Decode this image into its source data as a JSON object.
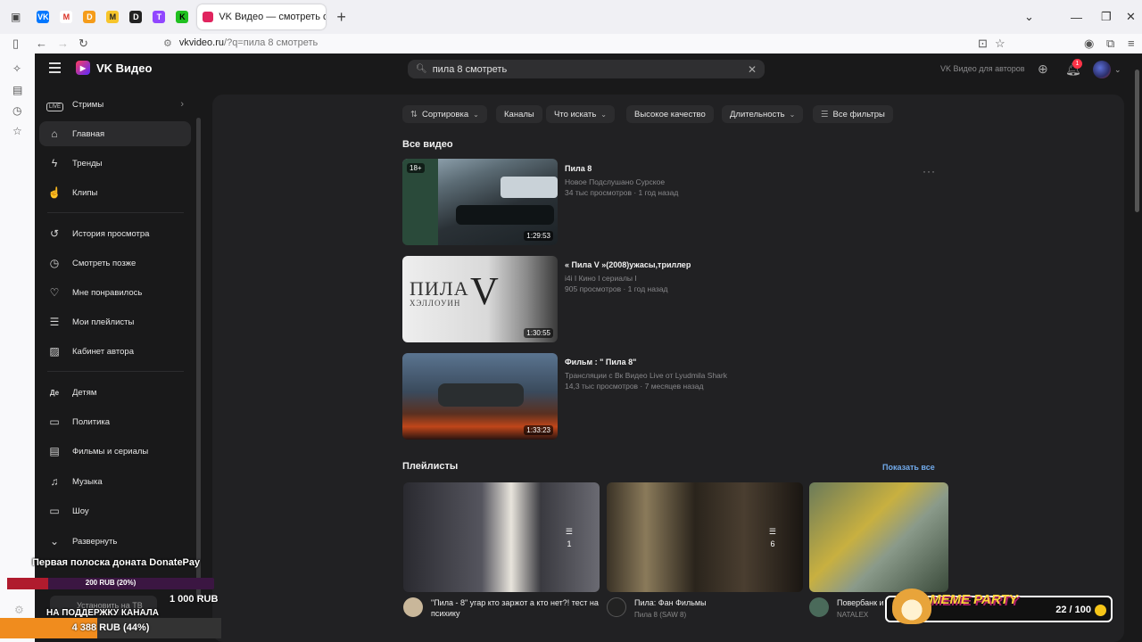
{
  "browser": {
    "tab_title": "VK Видео — смотреть онлайн",
    "url_domain": "vkvideo.ru",
    "url_path": "/?q=пила 8 смотреть",
    "pinned_tabs": [
      {
        "name": "vk-pinned-tab",
        "label": "VK",
        "color": "#0077ff"
      },
      {
        "name": "gmail-pinned-tab",
        "label": "M",
        "color": "#d93025"
      },
      {
        "name": "donationalerts-pinned-tab",
        "label": "D",
        "color": "#f59c1a"
      },
      {
        "name": "miro-pinned-tab",
        "label": "M",
        "color": "#f7c52b"
      },
      {
        "name": "dtf-pinned-tab",
        "label": "D",
        "color": "#222222"
      },
      {
        "name": "twitch-pinned-tab",
        "label": "T",
        "color": "#9146ff"
      },
      {
        "name": "kick-pinned-tab",
        "label": "K",
        "color": "#20c020"
      }
    ]
  },
  "header": {
    "logo": "VK Видео",
    "search_value": "пила 8 смотреть",
    "authors_link": "VK Видео для авторов",
    "notifications_count": "1"
  },
  "sidebar": {
    "items": [
      {
        "label": "Стримы",
        "icon": "live-icon"
      },
      {
        "label": "Главная",
        "icon": "home-icon"
      },
      {
        "label": "Тренды",
        "icon": "lightning-icon"
      },
      {
        "label": "Клипы",
        "icon": "clips-icon"
      },
      {
        "label": "История просмотра",
        "icon": "history-icon"
      },
      {
        "label": "Смотреть позже",
        "icon": "clock-icon"
      },
      {
        "label": "Мне понравилось",
        "icon": "heart-icon"
      },
      {
        "label": "Мои плейлисты",
        "icon": "playlist-icon"
      },
      {
        "label": "Кабинет автора",
        "icon": "chart-icon"
      },
      {
        "label": "Детям",
        "icon": "kids-icon"
      },
      {
        "label": "Политика",
        "icon": "book-icon"
      },
      {
        "label": "Фильмы и сериалы",
        "icon": "clapper-icon"
      },
      {
        "label": "Музыка",
        "icon": "music-icon"
      },
      {
        "label": "Шоу",
        "icon": "tv-icon"
      },
      {
        "label": "Развернуть",
        "icon": "chevron-down-icon"
      }
    ],
    "install_tv": "Установить на ТВ"
  },
  "filters": {
    "sort": "Сортировка",
    "channels": "Каналы",
    "what": "Что искать",
    "quality": "Высокое качество",
    "duration": "Длительность",
    "all": "Все фильтры"
  },
  "videos_section": {
    "title": "Все видео",
    "items": [
      {
        "title": "Пила 8",
        "channel": "Новое Подслушано Сурское",
        "stats": "34 тыс просмотров · 1 год назад",
        "duration": "1:29:53",
        "age": "18+"
      },
      {
        "title": "« Пила V »(2008)ужасы,триллер",
        "channel": "i4i I Кино I сериалы I",
        "stats": "905 просмотров · 1 год назад",
        "duration": "1:30:55",
        "thumb_text_main": "ПИЛА",
        "thumb_text_sub": "ХЭЛЛОУИН",
        "thumb_numeral": "V"
      },
      {
        "title": "Фильм : \" Пила 8\"",
        "channel": "Трансляции с Вк Видео Live от Lyudmila Shark",
        "stats": "14,3 тыс просмотров · 7 месяцев назад",
        "duration": "1:33:23"
      }
    ]
  },
  "playlists_section": {
    "title": "Плейлисты",
    "show_all": "Показать все",
    "items": [
      {
        "title": "\"Пила - 8\" угар кто заржот а кто нет?! тест на психику",
        "subtitle": "",
        "count": "1"
      },
      {
        "title": "Пила: Фан Фильмы",
        "subtitle": "Пила 8 (SAW 8)",
        "count": "6"
      },
      {
        "title": "Повербанк и",
        "subtitle": "NATALEX",
        "count": ""
      }
    ]
  },
  "overlay": {
    "donate_title": "Первая полоска доната DonatePay",
    "donate_progress_text": "200 RUB (20%)",
    "donate_progress": 0.2,
    "donate_goal": "1 000 RUB",
    "support_text": "НА ПОДДЕРЖКУ КАНАЛА",
    "support_progress_text": "4 388 RUB (44%)",
    "support_progress": 0.44,
    "meme_title": "MEME PARTY",
    "meme_count": "22 / 100"
  }
}
